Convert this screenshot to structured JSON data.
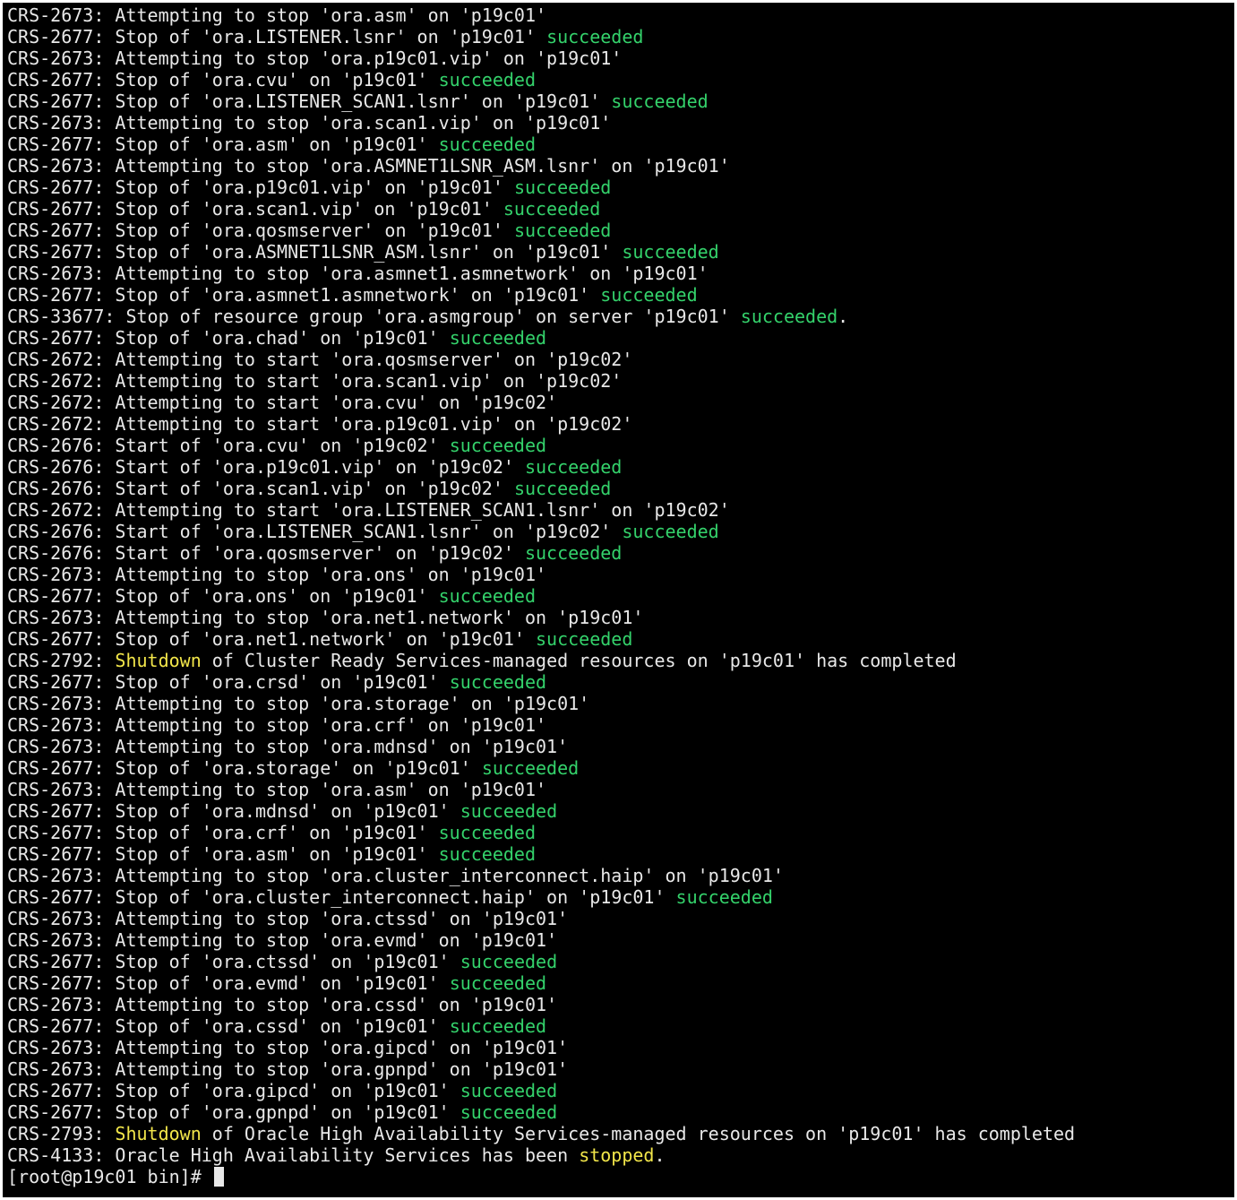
{
  "colors": {
    "background": "#000000",
    "default_text": "#e8e8e8",
    "success_green": "#34d26b",
    "highlight_yellow": "#f2e64a"
  },
  "terminal": {
    "lines": [
      {
        "segments": [
          {
            "text": "CRS-2673: Attempting to stop 'ora.asm' on 'p19c01'",
            "color": "default"
          }
        ]
      },
      {
        "segments": [
          {
            "text": "CRS-2677: Stop of 'ora.LISTENER.lsnr' on 'p19c01' ",
            "color": "default"
          },
          {
            "text": "succeeded",
            "color": "green"
          }
        ]
      },
      {
        "segments": [
          {
            "text": "CRS-2673: Attempting to stop 'ora.p19c01.vip' on 'p19c01'",
            "color": "default"
          }
        ]
      },
      {
        "segments": [
          {
            "text": "CRS-2677: Stop of 'ora.cvu' on 'p19c01' ",
            "color": "default"
          },
          {
            "text": "succeeded",
            "color": "green"
          }
        ]
      },
      {
        "segments": [
          {
            "text": "CRS-2677: Stop of 'ora.LISTENER_SCAN1.lsnr' on 'p19c01' ",
            "color": "default"
          },
          {
            "text": "succeeded",
            "color": "green"
          }
        ]
      },
      {
        "segments": [
          {
            "text": "CRS-2673: Attempting to stop 'ora.scan1.vip' on 'p19c01'",
            "color": "default"
          }
        ]
      },
      {
        "segments": [
          {
            "text": "CRS-2677: Stop of 'ora.asm' on 'p19c01' ",
            "color": "default"
          },
          {
            "text": "succeeded",
            "color": "green"
          }
        ]
      },
      {
        "segments": [
          {
            "text": "CRS-2673: Attempting to stop 'ora.ASMNET1LSNR_ASM.lsnr' on 'p19c01'",
            "color": "default"
          }
        ]
      },
      {
        "segments": [
          {
            "text": "CRS-2677: Stop of 'ora.p19c01.vip' on 'p19c01' ",
            "color": "default"
          },
          {
            "text": "succeeded",
            "color": "green"
          }
        ]
      },
      {
        "segments": [
          {
            "text": "CRS-2677: Stop of 'ora.scan1.vip' on 'p19c01' ",
            "color": "default"
          },
          {
            "text": "succeeded",
            "color": "green"
          }
        ]
      },
      {
        "segments": [
          {
            "text": "CRS-2677: Stop of 'ora.qosmserver' on 'p19c01' ",
            "color": "default"
          },
          {
            "text": "succeeded",
            "color": "green"
          }
        ]
      },
      {
        "segments": [
          {
            "text": "CRS-2677: Stop of 'ora.ASMNET1LSNR_ASM.lsnr' on 'p19c01' ",
            "color": "default"
          },
          {
            "text": "succeeded",
            "color": "green"
          }
        ]
      },
      {
        "segments": [
          {
            "text": "CRS-2673: Attempting to stop 'ora.asmnet1.asmnetwork' on 'p19c01'",
            "color": "default"
          }
        ]
      },
      {
        "segments": [
          {
            "text": "CRS-2677: Stop of 'ora.asmnet1.asmnetwork' on 'p19c01' ",
            "color": "default"
          },
          {
            "text": "succeeded",
            "color": "green"
          }
        ]
      },
      {
        "segments": [
          {
            "text": "CRS-33677: Stop of resource group 'ora.asmgroup' on server 'p19c01' ",
            "color": "default"
          },
          {
            "text": "succeeded",
            "color": "green"
          },
          {
            "text": ".",
            "color": "default"
          }
        ]
      },
      {
        "segments": [
          {
            "text": "CRS-2677: Stop of 'ora.chad' on 'p19c01' ",
            "color": "default"
          },
          {
            "text": "succeeded",
            "color": "green"
          }
        ]
      },
      {
        "segments": [
          {
            "text": "CRS-2672: Attempting to start 'ora.qosmserver' on 'p19c02'",
            "color": "default"
          }
        ]
      },
      {
        "segments": [
          {
            "text": "CRS-2672: Attempting to start 'ora.scan1.vip' on 'p19c02'",
            "color": "default"
          }
        ]
      },
      {
        "segments": [
          {
            "text": "CRS-2672: Attempting to start 'ora.cvu' on 'p19c02'",
            "color": "default"
          }
        ]
      },
      {
        "segments": [
          {
            "text": "CRS-2672: Attempting to start 'ora.p19c01.vip' on 'p19c02'",
            "color": "default"
          }
        ]
      },
      {
        "segments": [
          {
            "text": "CRS-2676: Start of 'ora.cvu' on 'p19c02' ",
            "color": "default"
          },
          {
            "text": "succeeded",
            "color": "green"
          }
        ]
      },
      {
        "segments": [
          {
            "text": "CRS-2676: Start of 'ora.p19c01.vip' on 'p19c02' ",
            "color": "default"
          },
          {
            "text": "succeeded",
            "color": "green"
          }
        ]
      },
      {
        "segments": [
          {
            "text": "CRS-2676: Start of 'ora.scan1.vip' on 'p19c02' ",
            "color": "default"
          },
          {
            "text": "succeeded",
            "color": "green"
          }
        ]
      },
      {
        "segments": [
          {
            "text": "CRS-2672: Attempting to start 'ora.LISTENER_SCAN1.lsnr' on 'p19c02'",
            "color": "default"
          }
        ]
      },
      {
        "segments": [
          {
            "text": "CRS-2676: Start of 'ora.LISTENER_SCAN1.lsnr' on 'p19c02' ",
            "color": "default"
          },
          {
            "text": "succeeded",
            "color": "green"
          }
        ]
      },
      {
        "segments": [
          {
            "text": "CRS-2676: Start of 'ora.qosmserver' on 'p19c02' ",
            "color": "default"
          },
          {
            "text": "succeeded",
            "color": "green"
          }
        ]
      },
      {
        "segments": [
          {
            "text": "CRS-2673: Attempting to stop 'ora.ons' on 'p19c01'",
            "color": "default"
          }
        ]
      },
      {
        "segments": [
          {
            "text": "CRS-2677: Stop of 'ora.ons' on 'p19c01' ",
            "color": "default"
          },
          {
            "text": "succeeded",
            "color": "green"
          }
        ]
      },
      {
        "segments": [
          {
            "text": "CRS-2673: Attempting to stop 'ora.net1.network' on 'p19c01'",
            "color": "default"
          }
        ]
      },
      {
        "segments": [
          {
            "text": "CRS-2677: Stop of 'ora.net1.network' on 'p19c01' ",
            "color": "default"
          },
          {
            "text": "succeeded",
            "color": "green"
          }
        ]
      },
      {
        "segments": [
          {
            "text": "CRS-2792: ",
            "color": "default"
          },
          {
            "text": "Shutdown",
            "color": "yellow"
          },
          {
            "text": " of Cluster Ready Services-managed resources on 'p19c01' has completed",
            "color": "default"
          }
        ]
      },
      {
        "segments": [
          {
            "text": "CRS-2677: Stop of 'ora.crsd' on 'p19c01' ",
            "color": "default"
          },
          {
            "text": "succeeded",
            "color": "green"
          }
        ]
      },
      {
        "segments": [
          {
            "text": "CRS-2673: Attempting to stop 'ora.storage' on 'p19c01'",
            "color": "default"
          }
        ]
      },
      {
        "segments": [
          {
            "text": "CRS-2673: Attempting to stop 'ora.crf' on 'p19c01'",
            "color": "default"
          }
        ]
      },
      {
        "segments": [
          {
            "text": "CRS-2673: Attempting to stop 'ora.mdnsd' on 'p19c01'",
            "color": "default"
          }
        ]
      },
      {
        "segments": [
          {
            "text": "CRS-2677: Stop of 'ora.storage' on 'p19c01' ",
            "color": "default"
          },
          {
            "text": "succeeded",
            "color": "green"
          }
        ]
      },
      {
        "segments": [
          {
            "text": "CRS-2673: Attempting to stop 'ora.asm' on 'p19c01'",
            "color": "default"
          }
        ]
      },
      {
        "segments": [
          {
            "text": "CRS-2677: Stop of 'ora.mdnsd' on 'p19c01' ",
            "color": "default"
          },
          {
            "text": "succeeded",
            "color": "green"
          }
        ]
      },
      {
        "segments": [
          {
            "text": "CRS-2677: Stop of 'ora.crf' on 'p19c01' ",
            "color": "default"
          },
          {
            "text": "succeeded",
            "color": "green"
          }
        ]
      },
      {
        "segments": [
          {
            "text": "CRS-2677: Stop of 'ora.asm' on 'p19c01' ",
            "color": "default"
          },
          {
            "text": "succeeded",
            "color": "green"
          }
        ]
      },
      {
        "segments": [
          {
            "text": "CRS-2673: Attempting to stop 'ora.cluster_interconnect.haip' on 'p19c01'",
            "color": "default"
          }
        ]
      },
      {
        "segments": [
          {
            "text": "CRS-2677: Stop of 'ora.cluster_interconnect.haip' on 'p19c01' ",
            "color": "default"
          },
          {
            "text": "succeeded",
            "color": "green"
          }
        ]
      },
      {
        "segments": [
          {
            "text": "CRS-2673: Attempting to stop 'ora.ctssd' on 'p19c01'",
            "color": "default"
          }
        ]
      },
      {
        "segments": [
          {
            "text": "CRS-2673: Attempting to stop 'ora.evmd' on 'p19c01'",
            "color": "default"
          }
        ]
      },
      {
        "segments": [
          {
            "text": "CRS-2677: Stop of 'ora.ctssd' on 'p19c01' ",
            "color": "default"
          },
          {
            "text": "succeeded",
            "color": "green"
          }
        ]
      },
      {
        "segments": [
          {
            "text": "CRS-2677: Stop of 'ora.evmd' on 'p19c01' ",
            "color": "default"
          },
          {
            "text": "succeeded",
            "color": "green"
          }
        ]
      },
      {
        "segments": [
          {
            "text": "CRS-2673: Attempting to stop 'ora.cssd' on 'p19c01'",
            "color": "default"
          }
        ]
      },
      {
        "segments": [
          {
            "text": "CRS-2677: Stop of 'ora.cssd' on 'p19c01' ",
            "color": "default"
          },
          {
            "text": "succeeded",
            "color": "green"
          }
        ]
      },
      {
        "segments": [
          {
            "text": "CRS-2673: Attempting to stop 'ora.gipcd' on 'p19c01'",
            "color": "default"
          }
        ]
      },
      {
        "segments": [
          {
            "text": "CRS-2673: Attempting to stop 'ora.gpnpd' on 'p19c01'",
            "color": "default"
          }
        ]
      },
      {
        "segments": [
          {
            "text": "CRS-2677: Stop of 'ora.gipcd' on 'p19c01' ",
            "color": "default"
          },
          {
            "text": "succeeded",
            "color": "green"
          }
        ]
      },
      {
        "segments": [
          {
            "text": "CRS-2677: Stop of 'ora.gpnpd' on 'p19c01' ",
            "color": "default"
          },
          {
            "text": "succeeded",
            "color": "green"
          }
        ]
      },
      {
        "segments": [
          {
            "text": "CRS-2793: ",
            "color": "default"
          },
          {
            "text": "Shutdown",
            "color": "yellow"
          },
          {
            "text": " of Oracle High Availability Services-managed resources on 'p19c01' has completed",
            "color": "default"
          }
        ]
      },
      {
        "segments": [
          {
            "text": "CRS-4133: Oracle High Availability Services has been ",
            "color": "default"
          },
          {
            "text": "stopped",
            "color": "yellow"
          },
          {
            "text": ".",
            "color": "default"
          }
        ]
      }
    ],
    "prompt": "[root@p19c01 bin]# "
  }
}
